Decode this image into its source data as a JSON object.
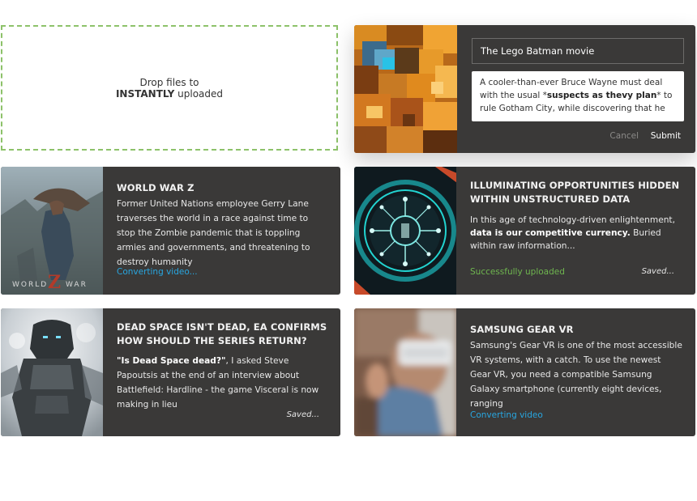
{
  "dropzone": {
    "line1": "Drop files to",
    "line2_bold": "INSTANTLY",
    "line2_rest": " uploaded"
  },
  "editor": {
    "title_value": "The Lego Batman movie",
    "desc_prefix": "A cooler-than-ever Bruce Wayne must deal with the usual *",
    "desc_bold": "suspects as thevy plan",
    "desc_suffix": "* to rule Gotham City, while discovering that he",
    "cancel_label": "Cancel",
    "submit_label": "Submit"
  },
  "cards": [
    {
      "title": "WORLD WAR Z",
      "desc": "Former United Nations employee Gerry Lane traverses the world in a race against time to stop the Zombie pandemic that is toppling armies and governments, and threatening to destroy humanity",
      "status": "Converting video...",
      "saved": "",
      "poster_text": "WORLD Z WAR"
    },
    {
      "title": "ILLUMINATING OPPORTUNITIES HIDDEN WITHIN UNSTRUCTURED DATA",
      "desc_prefix": "In this age of technology-driven enlightenment, ",
      "desc_bold": "data is our competitive currency.",
      "desc_suffix": " Buried within raw information...",
      "status": "Successfully uploaded",
      "saved": "Saved..."
    },
    {
      "title": "DEAD SPACE ISN'T DEAD, EA CONFIRMS HOW SHOULD THE SERIES RETURN?",
      "desc_bold": "\"Is Dead Space dead?\"",
      "desc_suffix": ", I asked Steve Papoutsis at the end of an interview about Battlefield: Hardline - the game Visceral is now making in lieu",
      "status": "",
      "saved": "Saved..."
    },
    {
      "title": "SAMSUNG GEAR VR",
      "desc": "Samsung's Gear VR is one of the most accessible VR systems, with a catch. To use the newest Gear VR, you need a compatible Samsung Galaxy smartphone (currently eight devices, ranging",
      "status": "Converting video",
      "saved": ""
    }
  ],
  "colors": {
    "card_bg": "#3a3938",
    "accent_blue": "#28a6e0",
    "accent_green": "#6fb64f",
    "dropzone_border": "#8dc26a"
  }
}
